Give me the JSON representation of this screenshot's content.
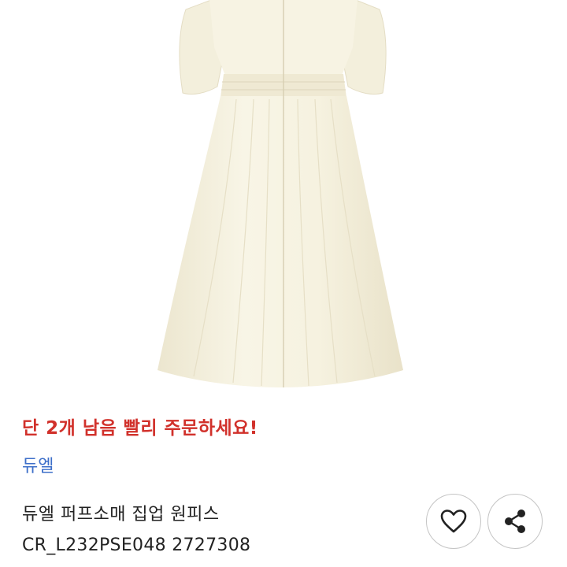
{
  "product": {
    "stock_alert": "단 2개 남음 빨리 주문하세요!",
    "brand": "듀엘",
    "name": "듀엘 퍼프소매 집업 원피스",
    "code": "CR_L232PSE048 2727308"
  },
  "image": {
    "subject": "cream puff-sleeve zip-up midi dress",
    "dress_color": "#f6f2e1"
  },
  "actions": {
    "like_icon": "heart-icon",
    "share_icon": "share-icon"
  },
  "colors": {
    "alert": "#d1312b",
    "brand_link": "#3d6fc9",
    "text": "#222222",
    "button_border": "#c4c4c4"
  }
}
